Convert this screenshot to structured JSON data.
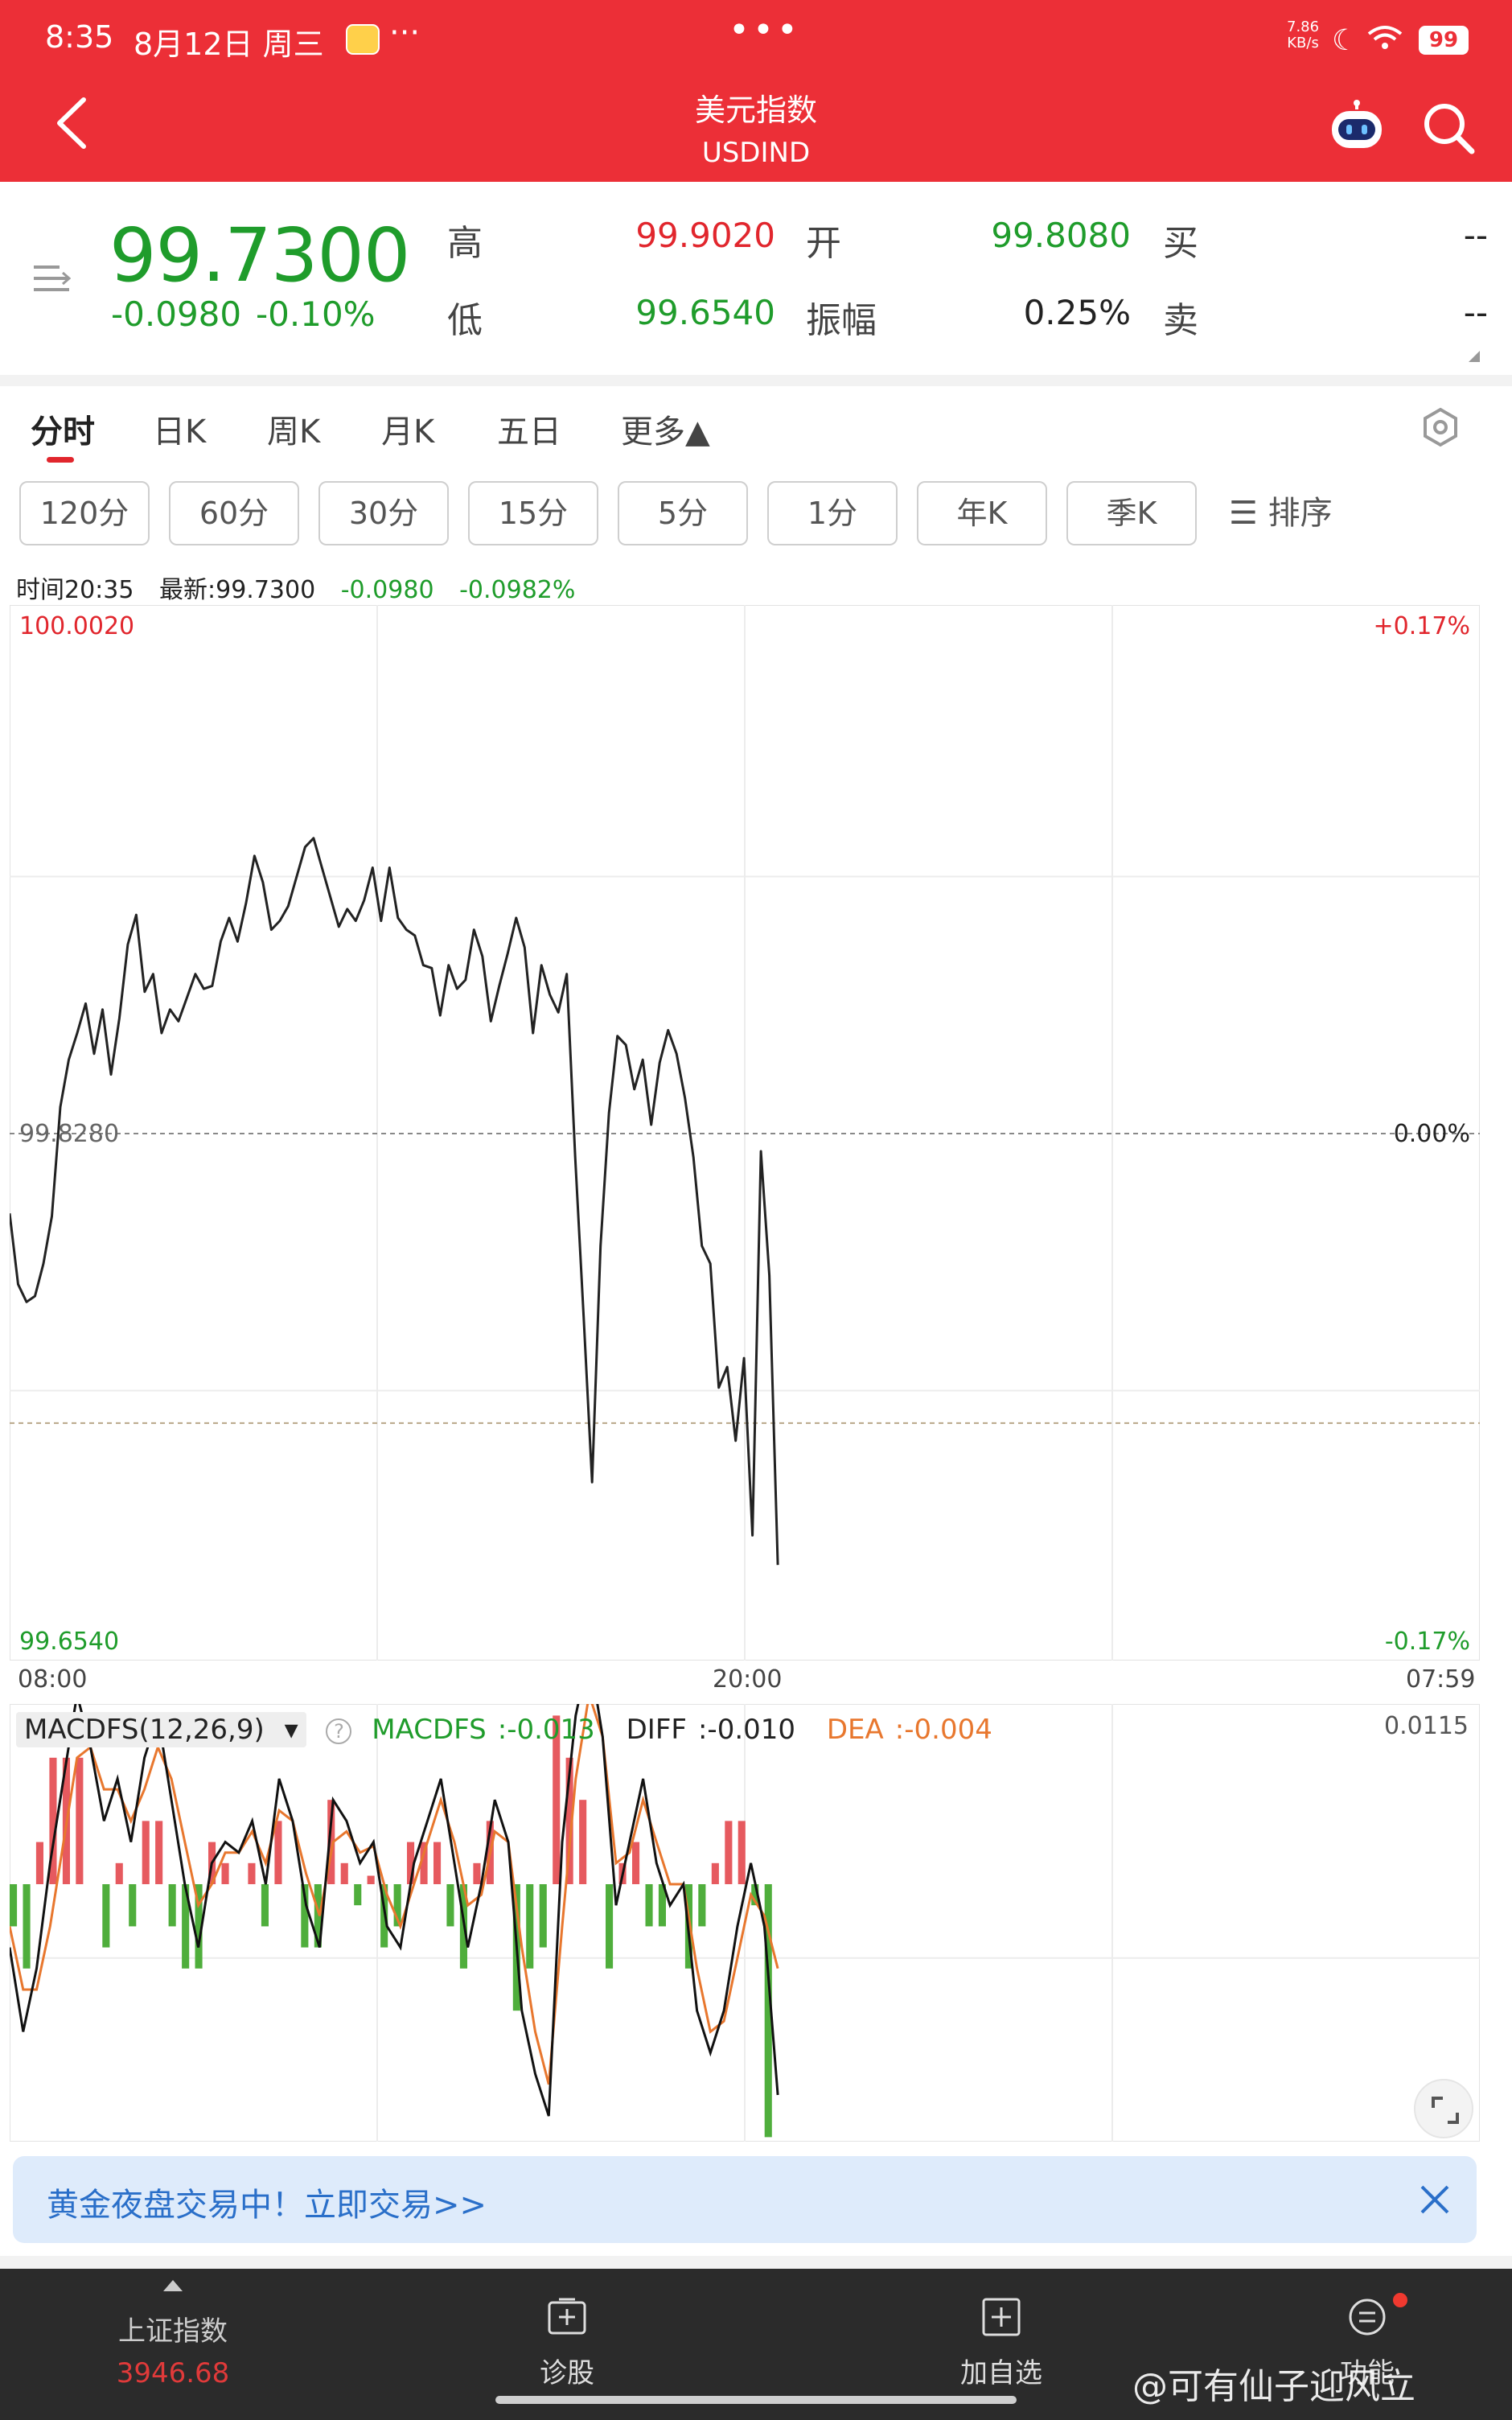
{
  "status_bar": {
    "time": "8:35",
    "date": "8月12日 周三",
    "more": "···",
    "speed_value": "7.86",
    "speed_unit": "KB/s",
    "battery": "99"
  },
  "header": {
    "title": "美元指数",
    "subtitle": "USDIND",
    "top_dots": "•••",
    "bg_color": "#ec2f37"
  },
  "quote": {
    "price": "99.7300",
    "change_abs": "-0.0980",
    "change_pct": "-0.10%",
    "high_label": "高",
    "high_value": "99.9020",
    "low_label": "低",
    "low_value": "99.6540",
    "open_label": "开",
    "open_value": "99.8080",
    "amplitude_label": "振幅",
    "amplitude_value": "0.25%",
    "buy_label": "买",
    "buy_value": "--",
    "sell_label": "卖",
    "sell_value": "--"
  },
  "tabs": [
    "分时",
    "日K",
    "周K",
    "月K",
    "五日",
    "更多▲"
  ],
  "periods": [
    "120分",
    "60分",
    "30分",
    "15分",
    "5分",
    "1分",
    "年K",
    "季K"
  ],
  "sort_label": "☰ 排序",
  "info_line": {
    "time": "时间20:35",
    "latest": "最新:99.7300",
    "change": "-0.0980",
    "pct": "-0.0982%"
  },
  "chart_data": [
    {
      "type": "line",
      "title": "",
      "x_ticks": [
        "08:00",
        "20:00",
        "07:59"
      ],
      "y_max_label": "100.0020",
      "y_min_label": "99.6540",
      "pct_max_label": "+0.17%",
      "pct_min_label": "-0.17%",
      "baseline_label": "99.8280",
      "baseline_pct_label": "0.00%",
      "ylim": [
        99.654,
        100.002
      ],
      "baseline": 99.828,
      "reference_value": 99.73,
      "series": [
        {
          "values": [
            99.801,
            99.777,
            99.771,
            99.773,
            99.784,
            99.8,
            99.837,
            99.853,
            99.862,
            99.872,
            99.855,
            99.87,
            99.848,
            99.867,
            99.892,
            99.902,
            99.876,
            99.882,
            99.862,
            99.87,
            99.866,
            99.874,
            99.882,
            99.877,
            99.878,
            99.893,
            99.901,
            99.893,
            99.906,
            99.922,
            99.913,
            99.897,
            99.9,
            99.905,
            99.915,
            99.925,
            99.928,
            99.918,
            99.908,
            99.898,
            99.904,
            99.9,
            99.907,
            99.918,
            99.9,
            99.918,
            99.901,
            99.897,
            99.895,
            99.885,
            99.884,
            99.868,
            99.885,
            99.877,
            99.88,
            99.897,
            99.888,
            99.866,
            99.878,
            99.889,
            99.901,
            99.891,
            99.862,
            99.885,
            99.875,
            99.869,
            99.882,
            99.82,
            99.766,
            99.71,
            99.79,
            99.835,
            99.861,
            99.858,
            99.843,
            99.853,
            99.831,
            99.852,
            99.863,
            99.855,
            99.84,
            99.82,
            99.79,
            99.784,
            99.742,
            99.749,
            99.724,
            99.752,
            99.692,
            99.822,
            99.78,
            99.682
          ]
        }
      ],
      "x_min_index": 0,
      "x_max_index": 410
    },
    {
      "type": "line",
      "title": "MACDFS(12,26,9)",
      "y_max_label": "0.0115",
      "legend": [
        {
          "name": "MACDFS",
          "value": "-0.013"
        },
        {
          "name": "DIFF",
          "value": "-0.010"
        },
        {
          "name": "DEA",
          "value": "-0.004"
        }
      ],
      "ylim": [
        -0.0115,
        0.0115
      ],
      "series": [
        {
          "name": "DIFF",
          "values": [
            -0.003,
            -0.007,
            -0.004,
            0.001,
            0.005,
            0.009,
            0.0065,
            0.003,
            0.005,
            0.002,
            0.006,
            0.008,
            0.004,
            0.0,
            -0.003,
            0.001,
            0.002,
            0.0015,
            0.003,
            0.0,
            0.005,
            0.003,
            -0.001,
            -0.003,
            0.004,
            0.003,
            0.001,
            0.002,
            -0.002,
            -0.003,
            0.001,
            0.003,
            0.005,
            0.001,
            -0.003,
            0.0,
            0.004,
            0.002,
            -0.006,
            -0.009,
            -0.011,
            0.002,
            0.008,
            0.011,
            0.007,
            -0.001,
            0.002,
            0.005,
            0.001,
            -0.001,
            0.0,
            -0.006,
            -0.008,
            -0.006,
            -0.002,
            0.001,
            -0.002,
            -0.01
          ]
        },
        {
          "name": "DEA",
          "values": [
            -0.002,
            -0.005,
            -0.005,
            -0.002,
            0.002,
            0.006,
            0.0065,
            0.0045,
            0.0045,
            0.003,
            0.0045,
            0.0065,
            0.005,
            0.002,
            -0.001,
            0.0,
            0.0015,
            0.0015,
            0.0025,
            0.001,
            0.0035,
            0.003,
            0.0005,
            -0.0015,
            0.002,
            0.0025,
            0.0015,
            0.0018,
            -0.0005,
            -0.002,
            0.0,
            0.002,
            0.004,
            0.002,
            -0.001,
            -0.0005,
            0.0025,
            0.002,
            -0.003,
            -0.007,
            -0.0095,
            -0.002,
            0.005,
            0.009,
            0.007,
            0.001,
            0.0015,
            0.004,
            0.002,
            0.0,
            0.0,
            -0.004,
            -0.007,
            -0.0065,
            -0.0035,
            -0.0005,
            -0.0015,
            -0.004
          ]
        },
        {
          "name": "MACDFS",
          "values": [
            -0.002,
            -0.004,
            0.002,
            0.006,
            0.006,
            0.006,
            0.0,
            -0.003,
            0.001,
            -0.002,
            0.003,
            0.003,
            -0.002,
            -0.004,
            -0.004,
            0.002,
            0.001,
            0.0,
            0.001,
            -0.002,
            0.003,
            0.0,
            -0.003,
            -0.003,
            0.004,
            0.001,
            -0.001,
            0.0004,
            -0.003,
            -0.002,
            0.002,
            0.002,
            0.002,
            -0.002,
            -0.004,
            0.001,
            0.003,
            0.0,
            -0.006,
            -0.004,
            -0.003,
            0.008,
            0.006,
            0.004,
            0.0,
            -0.004,
            0.001,
            0.002,
            -0.002,
            -0.002,
            0.0,
            -0.004,
            -0.002,
            0.001,
            0.003,
            0.003,
            -0.001,
            -0.012
          ]
        }
      ]
    }
  ],
  "banner": {
    "text": "黄金夜盘交易中！立即交易>>"
  },
  "bottom_bar": {
    "index_name": "上证指数",
    "index_value": "3946.68",
    "diagnose_label": "诊股",
    "add_watch_label": "加自选",
    "function_label": "功能"
  },
  "watermark": "@可有仙子迎风立",
  "colors": {
    "accent": "#ec2f37",
    "up": "#e1262d",
    "down": "#1f9c2b",
    "dea_line": "#e8772e",
    "diff_line": "#111111"
  },
  "icons": [
    "back-icon",
    "robot-icon",
    "search-icon",
    "menu-lines-icon",
    "settings-icon",
    "fullscreen-icon",
    "close-icon",
    "diagnose-icon",
    "add-watch-icon",
    "function-icon",
    "moon-icon",
    "wifi-icon"
  ]
}
